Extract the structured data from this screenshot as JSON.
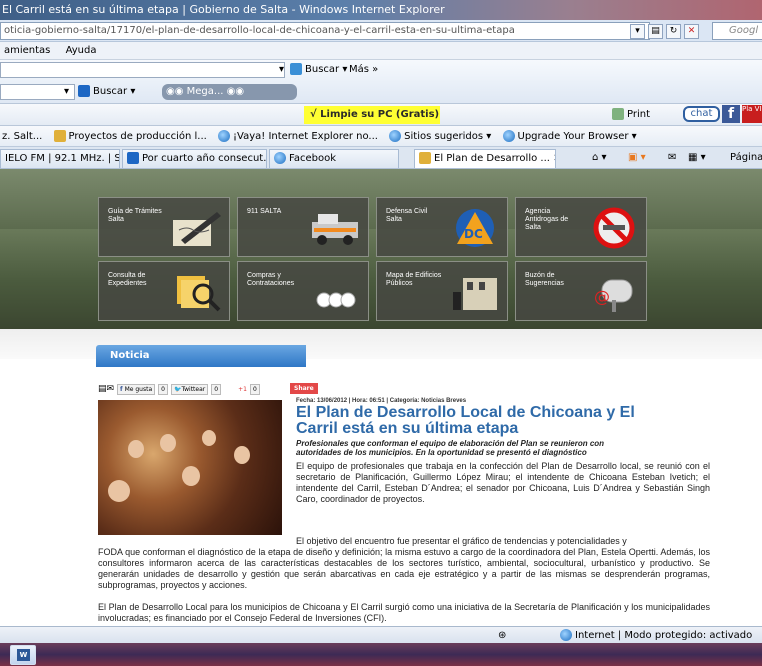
{
  "window": {
    "title": "El Carril está en su última etapa | Gobierno de Salta - Windows Internet Explorer",
    "address": "oticia-gobierno-salta/17170/el-plan-de-desarrollo-local-de-chicoana-y-el-carril-esta-en-su-ultima-etapa",
    "search_engine": "Googl"
  },
  "menu": {
    "items": [
      "amientas",
      "Ayuda"
    ]
  },
  "toolbar1": {
    "buscar_label": "Buscar",
    "mas_label": "Más »"
  },
  "toolbar2": {
    "buscar_label": "Buscar",
    "mega_label": "Mega...",
    "limpie_label": "√ Limpie su PC (Gratis)",
    "print_label": "Print",
    "chat_label": "chat",
    "plus_label": "Pla VID"
  },
  "favorites": {
    "items": [
      "z. Salt...",
      "Proyectos de producción l...",
      "¡Vaya! Internet Explorer no...",
      "Sitios sugeridos ▾",
      "Upgrade Your Browser ▾"
    ]
  },
  "tabs": {
    "items": [
      "IELO FM | 92.1 MHz. | S...",
      "Por cuarto año consecut...",
      "Facebook",
      "El Plan de Desarrollo ..."
    ],
    "pagina_label": "Página"
  },
  "tiles": [
    {
      "label": "Guía de Trámites Salta"
    },
    {
      "label": "911 SALTA"
    },
    {
      "label": "Defensa Civil Salta"
    },
    {
      "label": "Agencia Antidrogas de Salta"
    },
    {
      "label": "Consulta de Expedientes"
    },
    {
      "label": "Compras y Contrataciones"
    },
    {
      "label": "Mapa de Edificios Públicos"
    },
    {
      "label": "Buzón de Sugerencias"
    }
  ],
  "section": {
    "label": "Noticia"
  },
  "share": {
    "like_label": "Me gusta",
    "like_count": "0",
    "twitter_label": "Twittear",
    "twitter_count": "0",
    "plus_label": "+1",
    "plus_count": "0",
    "share_label": "Share"
  },
  "article": {
    "meta": "Fecha: 13/06/2012 | Hora: 06:51 | Categoría: Noticias Breves",
    "title": "El Plan de Desarrollo Local de Chicoana y El Carril está en su última etapa",
    "subtitle": "Profesionales que conforman el equipo de elaboración del Plan se reunieron con autoridades de los municipios. En la oportunidad se presentó el diagnóstico",
    "p1": "El equipo de profesionales que trabaja en la confección del Plan de Desarrollo local, se reunió con el secretario de Planificación, Guillermo López Mirau; el intendente de Chicoana Esteban Ivetich; el intendente del Carril, Esteban D´Andrea; el senador por Chicoana, Luis D´Andrea y Sebastián Singh Caro, coordinador de proyectos.",
    "p2a": "El objetivo del encuentro fue presentar el gráfico de tendencias y potencialidades y",
    "p2b": "FODA que conforman el diagnóstico de la etapa de diseño y definición; la misma estuvo a cargo de la coordinadora del Plan, Estela Opertti. Además, los consultores informaron acerca de las características destacables de los sectores turístico, ambiental, sociocultural, urbanístico y productivo. Se generarán unidades de desarrollo y gestión que serán abarcativas en cada eje estratégico y a partir de las mismas se desprenderán programas, subprogramas, proyectos y acciones.",
    "p3": "El Plan de Desarrollo Local para los municipios de Chicoana y El Carril surgió como una iniciativa de la Secretaría de Planificación y los municipalidades involucradas; es financiado por el Consejo Federal de Inversiones (CFI)."
  },
  "status": {
    "zone_label": "Internet | Modo protegido: activado"
  },
  "colors": {
    "headline": "#2f6aa8",
    "noticia_tab": "#3f86d0",
    "limpie": "#ffff33"
  }
}
